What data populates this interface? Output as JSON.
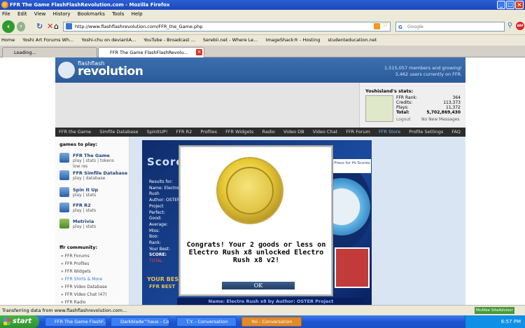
{
  "window": {
    "title": "FFR The Game FlashFlashRevolution.com - Mozilla Firefox"
  },
  "menu": [
    "File",
    "Edit",
    "View",
    "History",
    "Bookmarks",
    "Tools",
    "Help"
  ],
  "nav": {
    "url": "http://www.flashflashrevolution.com/FFR_the_Game.php",
    "search_placeholder": "Google"
  },
  "bookmarks": [
    "Home",
    "Yoshi Art Forums  Wh...",
    "Yoshi-chu on deviantA...",
    "YouTube - Broadcast ...",
    "Serebii.net - Where Le...",
    "ImageShack® - Hosting",
    "studenteducation.net"
  ],
  "tabs": [
    {
      "label": "Loading..."
    },
    {
      "label": "FFR The Game FlashFlashRevolu..."
    }
  ],
  "site": {
    "logo_small": "flashflash",
    "logo_big": "revolution",
    "banner_members": "1,515,057 members and growing!",
    "banner_online": "3,462 users currently on FFR.",
    "stats_title": "Yoshisland's stats:",
    "stats": [
      {
        "label": "FFR Rank:",
        "value": "364"
      },
      {
        "label": "Credits:",
        "value": "113,373"
      },
      {
        "label": "Plays:",
        "value": "11,372"
      },
      {
        "label": "Total:",
        "value": "5,702,869,430"
      }
    ],
    "logout": "Logout",
    "messages": "No New Messages",
    "navstrip": [
      "FFR the Game",
      "Simfile Database",
      "SpinItUP!",
      "FFR R2",
      "Profiles",
      "FFR Widgets",
      "Radio",
      "Video DB",
      "Video Chat",
      "FFR Forum",
      "FFR Store",
      "Profile Settings",
      "FAQ"
    ],
    "games_heading": "games to play:",
    "games": [
      {
        "title": "FFR The Game",
        "sub1": "play | stats | tokens",
        "sub2": "low res"
      },
      {
        "title": "FFR Simfile Database",
        "sub1": "play | database",
        "sub2": ""
      },
      {
        "title": "Spin It Up",
        "sub1": "play | stats",
        "sub2": ""
      },
      {
        "title": "FFR R2",
        "sub1": "play | stats",
        "sub2": ""
      },
      {
        "title": "Metrivia",
        "sub1": "play | stats",
        "sub2": ""
      }
    ],
    "community_heading": "ffr community:",
    "community": [
      "FFR Forums",
      "FFR Profiles",
      "FFR Widgets",
      "FFR Shirts & More",
      "FFR Video Database",
      "FFR Video Chat (47)",
      "FFR Radio"
    ]
  },
  "game": {
    "score_label": "Score",
    "results": [
      "Results for:",
      "Name: Electro Rush",
      "Author: OSTER Project",
      "Perfect:",
      "Good:",
      "Average:",
      "Miss:",
      "Boo:",
      "Rank:",
      "Your Best:",
      "SCORE:",
      "TOTAL:"
    ],
    "side_button": "Press for Hi-Scores",
    "your_best": "YOUR BEST",
    "ffr_best": "FFR BEST",
    "bottom_text": "Name: Electro Rush x8  by  Author: OSTER Project"
  },
  "modal": {
    "message": "Congrats! Your 2 goods or less on Electro Rush x8 unlocked Electro Rush x8 v2!",
    "ok": "OK"
  },
  "status": {
    "text": "Transferring data from www.flashflashrevolution.com...",
    "mcafee": "McAfee SiteAdvisor"
  },
  "taskbar": {
    "start": "start",
    "tasks": [
      "FFR The Game FlashF...",
      "Darkblade^haus - Co...",
      "T.Y. - Conversation",
      "Yoi - Conversation"
    ],
    "clock": "6:57 PM"
  },
  "colors": {
    "banner": "#3d70b0",
    "navstrip": "#2c2c2c",
    "ok_button": "#2d4f7c",
    "coin": "#e7c932"
  }
}
